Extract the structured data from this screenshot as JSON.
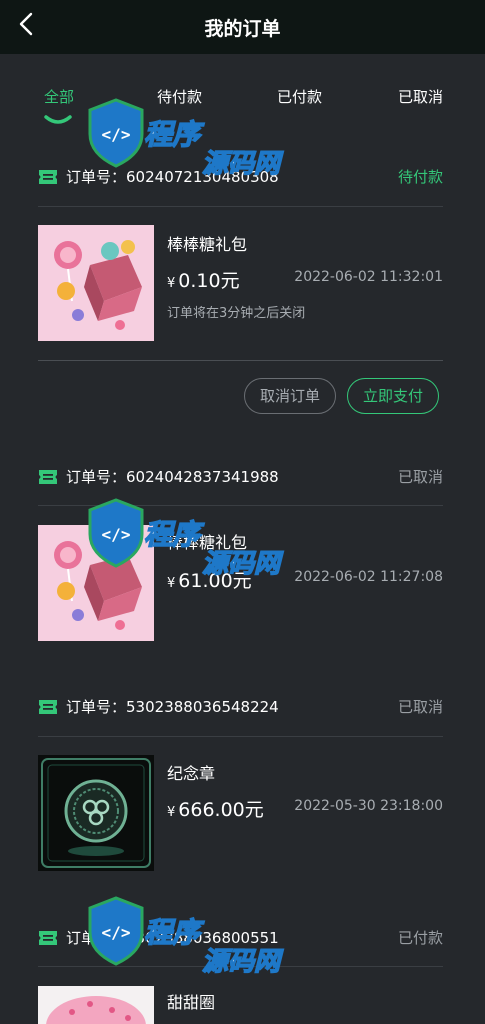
{
  "header": {
    "title": "我的订单"
  },
  "tabs": [
    {
      "label": "全部",
      "active": true
    },
    {
      "label": "待付款",
      "active": false
    },
    {
      "label": "已付款",
      "active": false
    },
    {
      "label": "已取消",
      "active": false
    }
  ],
  "orders": [
    {
      "order_label": "订单号：",
      "order_no": "6024072130480308",
      "status": "待付款",
      "product": "棒棒糖礼包",
      "currency": "¥",
      "price": "0.10元",
      "time": "2022-06-02 11:32:01",
      "note": "订单将在3分钟之后关闭",
      "cancel_label": "取消订单",
      "pay_label": "立即支付"
    },
    {
      "order_label": "订单号：",
      "order_no": "6024042837341988",
      "status": "已取消",
      "product": "棒棒糖礼包",
      "currency": "¥",
      "price": "61.00元",
      "time": "2022-06-02 11:27:08"
    },
    {
      "order_label": "订单号：",
      "order_no": "5302388036548224",
      "status": "已取消",
      "product": "纪念章",
      "currency": "¥",
      "price": "666.00元",
      "time": "2022-05-30 23:18:00"
    },
    {
      "order_label": "订单号：",
      "order_no": "5302388036800551",
      "status": "已付款",
      "product": "甜甜圈"
    }
  ],
  "watermark": {
    "text": "程序源码网"
  },
  "colors": {
    "accent": "#34c779",
    "background": "#25282c",
    "topbar": "#0e1614"
  },
  "icons": {
    "back": "chevron-left-icon",
    "order": "order-ticket-icon"
  }
}
